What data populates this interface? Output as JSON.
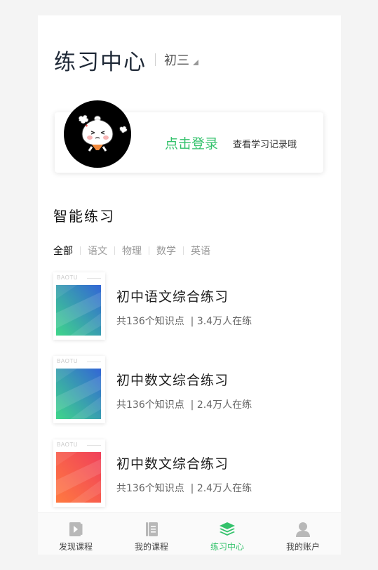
{
  "header": {
    "title": "练习中心",
    "grade": "初三"
  },
  "login": {
    "link": "点击登录",
    "hint": "查看学习记录哦"
  },
  "section": {
    "title": "智能练习"
  },
  "filters": [
    "全部",
    "语文",
    "物理",
    "数学",
    "英语"
  ],
  "exercises": [
    {
      "brand": "BAOTU",
      "title": "初中语文综合练习",
      "points": "共136个知识点",
      "learners": "3.4万人在练",
      "theme": "blue-green"
    },
    {
      "brand": "BAOTU",
      "title": "初中数文综合练习",
      "points": "共136个知识点",
      "learners": "2.4万人在练",
      "theme": "blue-green"
    },
    {
      "brand": "BAOTU",
      "title": "初中数文综合练习",
      "points": "共136个知识点",
      "learners": "2.4万人在练",
      "theme": "red-orange"
    }
  ],
  "tabbar": [
    {
      "label": "发现课程",
      "icon": "play-book-icon"
    },
    {
      "label": "我的课程",
      "icon": "course-list-icon"
    },
    {
      "label": "练习中心",
      "icon": "layers-icon",
      "active": true
    },
    {
      "label": "我的账户",
      "icon": "user-icon"
    }
  ],
  "colors": {
    "accent": "#33c26b",
    "cover_blue": "#3366d6",
    "cover_green": "#3fd68a",
    "cover_red": "#f0405a",
    "cover_orange": "#ff7a40"
  }
}
